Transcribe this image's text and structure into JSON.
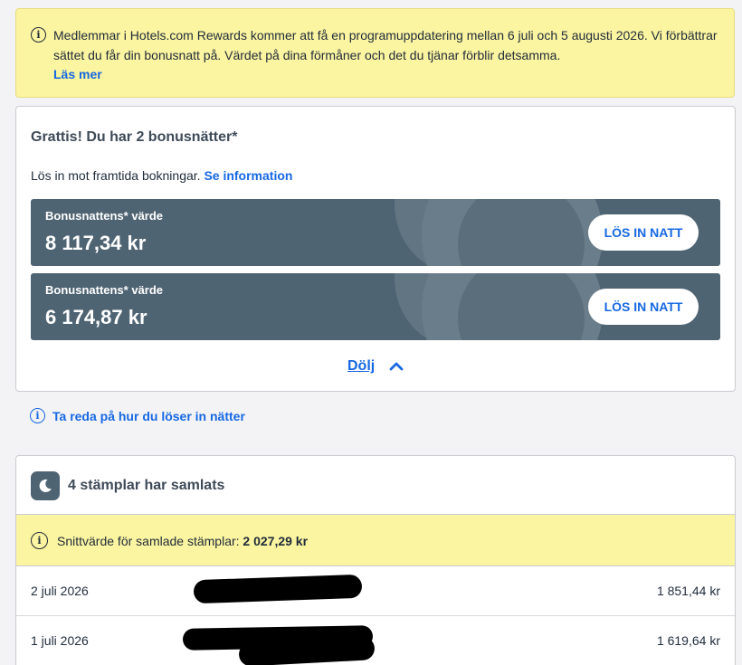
{
  "notice": {
    "text": "Medlemmar i Hotels.com Rewards kommer att få en programuppdatering mellan 6 juli och 5 augusti 2026. Vi förbättrar sättet du får din bonusnatt på. Värdet på dina förmåner och det du tjänar förblir detsamma.",
    "link": "Läs mer"
  },
  "bonus": {
    "title": "Grattis! Du har 2 bonusnätter*",
    "subtitle": "Lös in mot framtida bokningar.",
    "info_link": "Se information",
    "nights": [
      {
        "label": "Bonusnattens* värde",
        "value": "8 117,34 kr",
        "button": "LÖS IN NATT"
      },
      {
        "label": "Bonusnattens* värde",
        "value": "6 174,87 kr",
        "button": "LÖS IN NATT"
      }
    ],
    "hide_label": "Dölj"
  },
  "howto_link": "Ta reda på hur du löser in nätter",
  "stamps": {
    "title": "4 stämplar har samlats",
    "avg_label": "Snittvärde för samlade stämplar:",
    "avg_value": "2 027,29 kr",
    "rows": [
      {
        "date": "2 juli 2026",
        "amount": "1 851,44 kr"
      },
      {
        "date": "1 juli 2026",
        "amount": "1 619,64 kr"
      }
    ]
  },
  "colors": {
    "accent": "#1668e3",
    "notice_bg": "#fbf4a0",
    "night_card_bg": "#4f6473"
  },
  "icons": {
    "notice": "info-icon",
    "howto": "info-icon",
    "stamps": "moon-icon",
    "hide": "chevron-up-icon"
  }
}
